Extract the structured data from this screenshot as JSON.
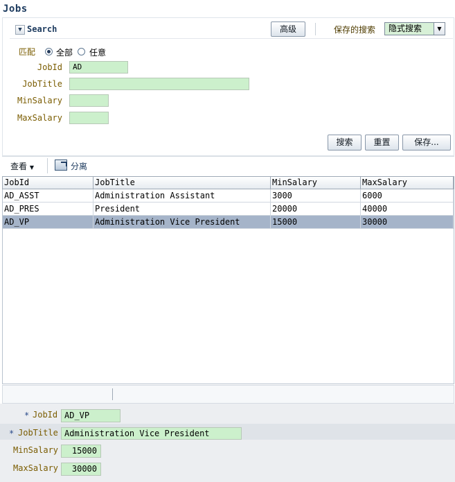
{
  "page": {
    "title": "Jobs"
  },
  "search": {
    "title": "Search",
    "advanced_label": "高级",
    "saved_search_label": "保存的搜索",
    "saved_search_value": "隐式搜索",
    "match_label": "匹配",
    "match_all": "全部",
    "match_any": "任意",
    "match_selected": "all",
    "fields": [
      {
        "label": "JobId",
        "value": "AD"
      },
      {
        "label": "JobTitle",
        "value": ""
      },
      {
        "label": "MinSalary",
        "value": ""
      },
      {
        "label": "MaxSalary",
        "value": ""
      }
    ],
    "search_button": "搜索",
    "reset_button": "重置",
    "save_button": "保存..."
  },
  "toolbar": {
    "view_label": "查看",
    "detach_label": "分离"
  },
  "table": {
    "columns": [
      "JobId",
      "JobTitle",
      "MinSalary",
      "MaxSalary"
    ],
    "rows": [
      [
        "AD_ASST",
        "Administration Assistant",
        "3000",
        "6000"
      ],
      [
        "AD_PRES",
        "President",
        "20000",
        "40000"
      ],
      [
        "AD_VP",
        "Administration Vice President",
        "15000",
        "30000"
      ]
    ],
    "selected_row": 2
  },
  "form": {
    "jobid_label": "JobId",
    "jobid_value": "AD_VP",
    "jobtitle_label": "JobTitle",
    "jobtitle_value": "Administration Vice President",
    "minsalary_label": "MinSalary",
    "minsalary_value": "15000",
    "maxsalary_label": "MaxSalary",
    "maxsalary_value": "30000",
    "required_mark": "*"
  }
}
